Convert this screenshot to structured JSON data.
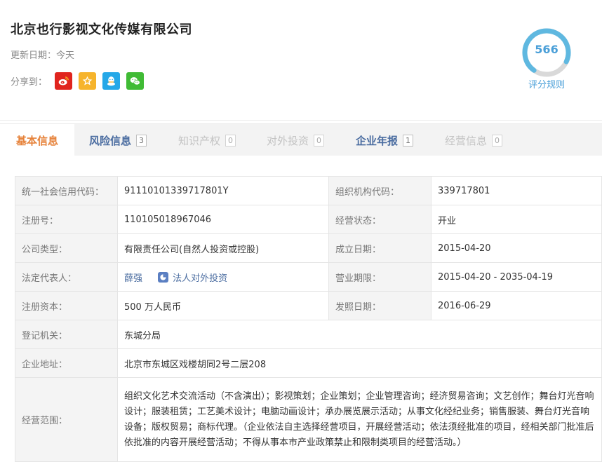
{
  "company": {
    "name": "北京也行影视文化传媒有限公司",
    "update_label": "更新日期：",
    "update_value": "今天",
    "share_label": "分享到："
  },
  "share": {
    "icons": [
      "weibo-icon",
      "qzone-icon",
      "qq-icon",
      "wechat-icon"
    ],
    "colors": {
      "weibo": "#e0241e",
      "qzone": "#f6b42c",
      "qq": "#25a8e8",
      "wechat": "#40bb35"
    }
  },
  "score": {
    "value": "566",
    "rule_label": "评分规则",
    "ring_fraction": 0.72,
    "ring_color": "#5fb8e0",
    "track_color": "#d9d9d9"
  },
  "tabs": [
    {
      "label": "基本信息",
      "count": "",
      "state": "active"
    },
    {
      "label": "风险信息",
      "count": "3",
      "state": "dark"
    },
    {
      "label": "知识产权",
      "count": "0",
      "state": "dim"
    },
    {
      "label": "对外投资",
      "count": "0",
      "state": "dim"
    },
    {
      "label": "企业年报",
      "count": "1",
      "state": "dark"
    },
    {
      "label": "经营信息",
      "count": "0",
      "state": "dim"
    }
  ],
  "info": {
    "credit_code_label": "统一社会信用代码：",
    "credit_code": "91110101339717801Y",
    "org_code_label": "组织机构代码：",
    "org_code": "339717801",
    "reg_no_label": "注册号：",
    "reg_no": "110105018967046",
    "status_label": "经营状态：",
    "status": "开业",
    "type_label": "公司类型：",
    "type": "有限责任公司(自然人投资或控股)",
    "founded_label": "成立日期：",
    "founded": "2015-04-20",
    "legal_rep_label": "法定代表人：",
    "legal_rep": "薛强",
    "legal_invest_link": "法人对外投资",
    "term_label": "营业期限：",
    "term": "2015-04-20 - 2035-04-19",
    "capital_label": "注册资本：",
    "capital": "500 万人民币",
    "issue_date_label": "发照日期：",
    "issue_date": "2016-06-29",
    "authority_label": "登记机关：",
    "authority": "东城分局",
    "address_label": "企业地址：",
    "address": "北京市东城区戏楼胡同2号二层208",
    "scope_label": "经营范围：",
    "scope": "组织文化艺术交流活动（不含演出）；影视策划；企业策划；企业管理咨询；经济贸易咨询；文艺创作；舞台灯光音响设计；服装租赁；工艺美术设计；电脑动画设计；承办展览展示活动；从事文化经纪业务；销售服装、舞台灯光音响设备；版权贸易；商标代理。（企业依法自主选择经营项目，开展经营活动；依法须经批准的项目，经相关部门批准后依批准的内容开展经营活动；不得从事本市产业政策禁止和限制类项目的经营活动。）"
  }
}
